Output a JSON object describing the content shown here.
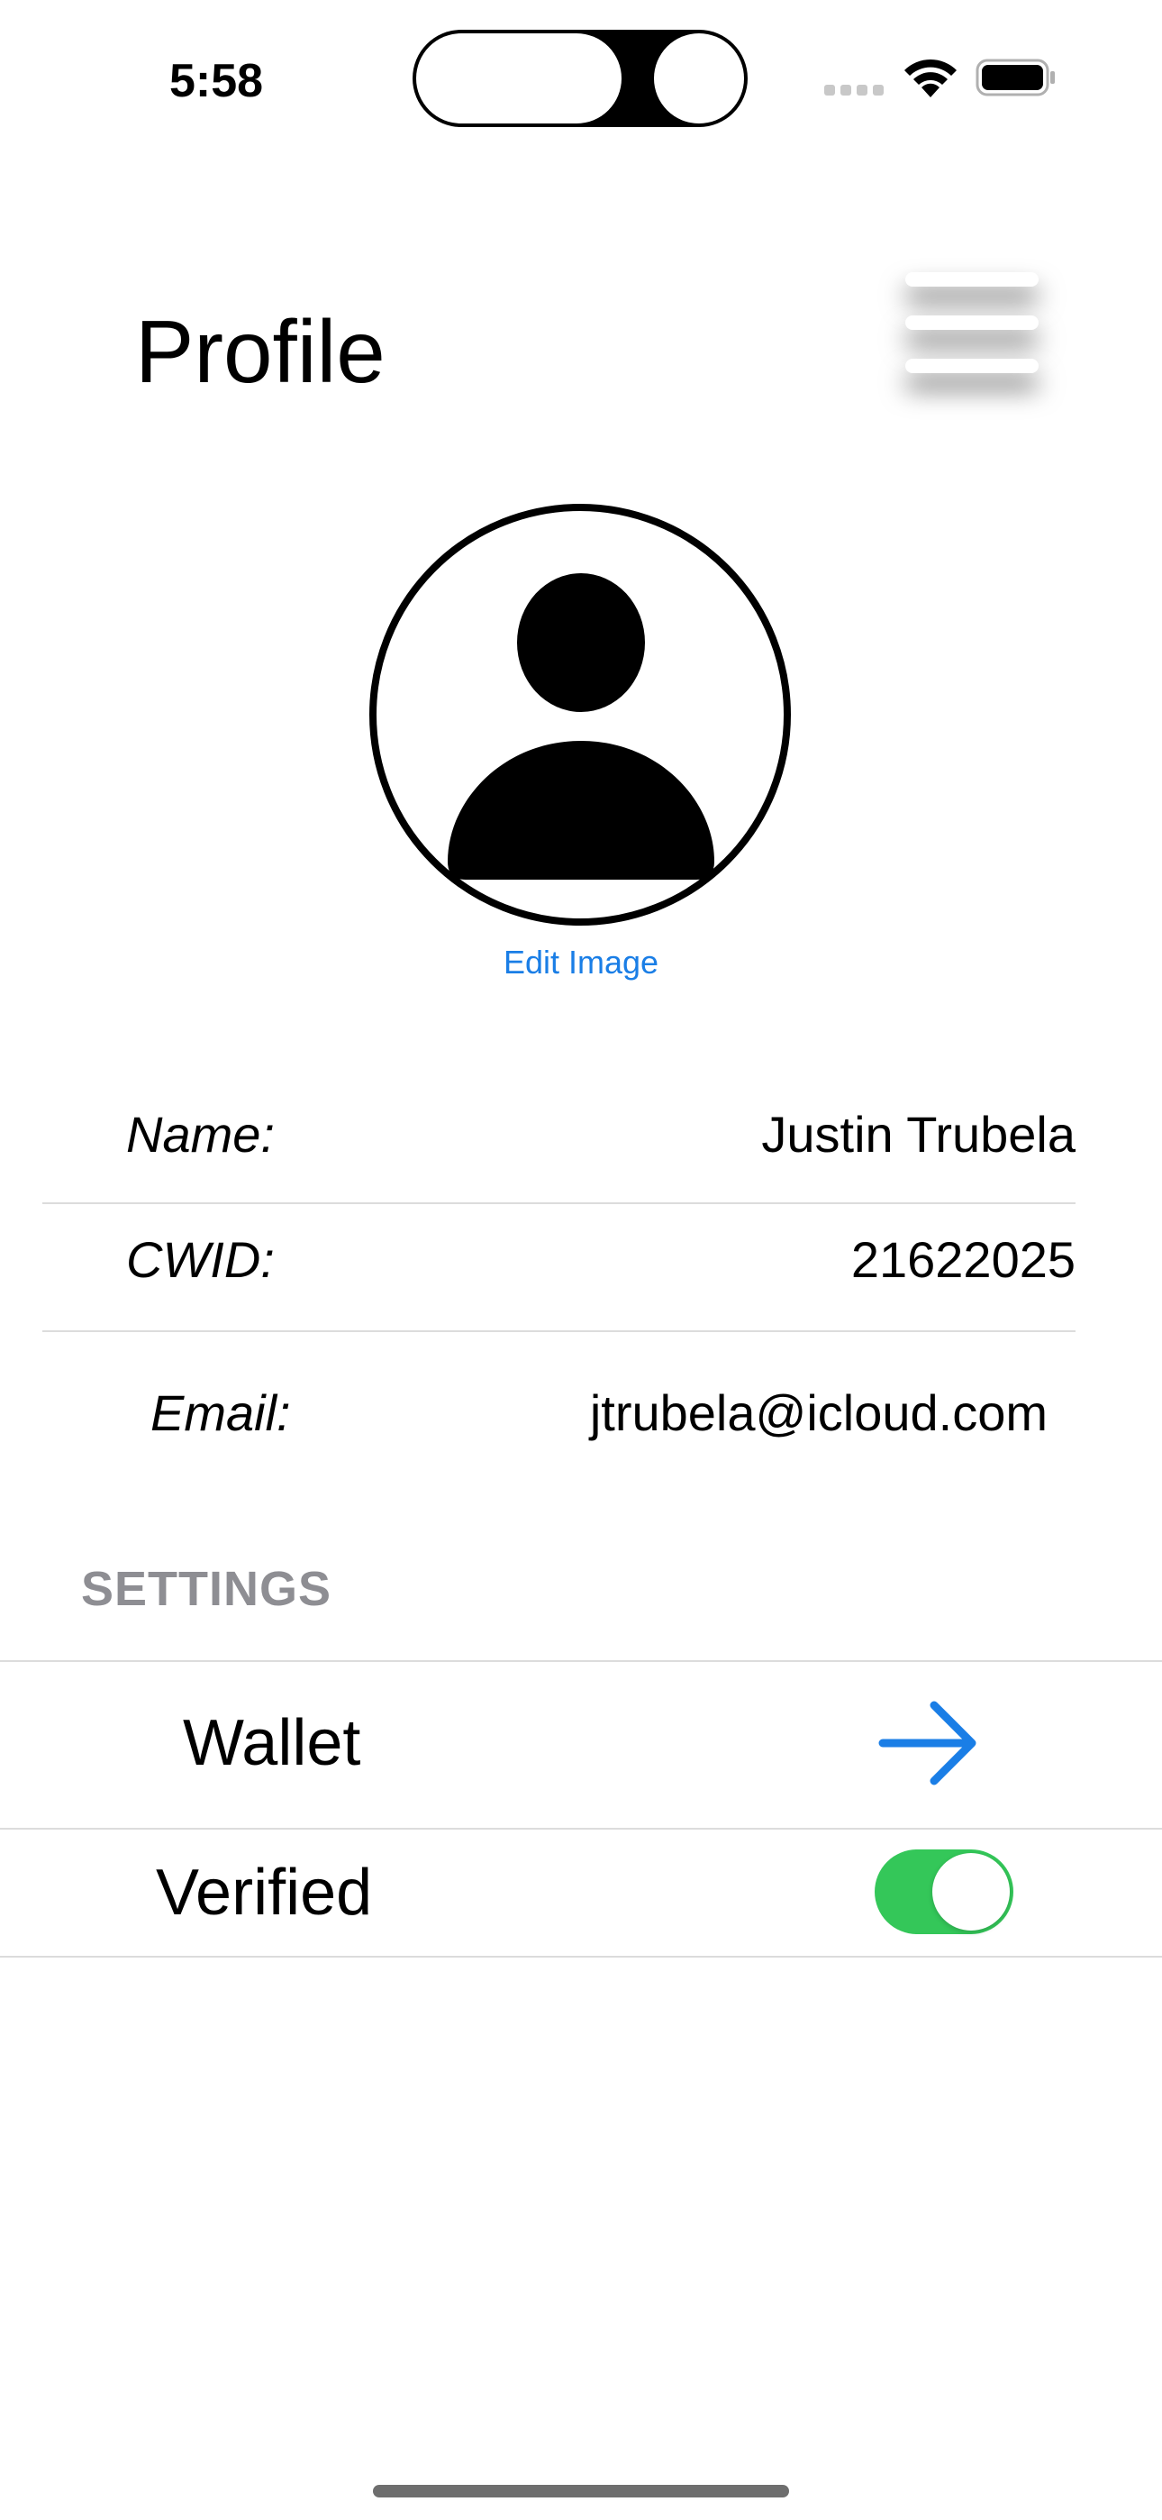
{
  "status_bar": {
    "time": "5:58",
    "wifi_icon": "wifi-icon",
    "battery_icon": "battery-icon",
    "signal_icon": "cellular-signal-icon"
  },
  "header": {
    "title": "Profile",
    "menu_icon": "hamburger-menu-icon"
  },
  "profile": {
    "avatar_icon": "person-circle-icon",
    "edit_image_label": "Edit Image"
  },
  "info": {
    "name_label": "Name:",
    "name_value": "Justin Trubela",
    "cwid_label": "CWID:",
    "cwid_value": "21622025",
    "email_label": "Email:",
    "email_value": "jtrubela@icloud.com"
  },
  "settings": {
    "header": "SETTINGS",
    "wallet_label": "Wallet",
    "wallet_icon": "arrow-right-icon",
    "verified_label": "Verified",
    "verified_on": true
  },
  "colors": {
    "accent_blue": "#1a7ee6",
    "toggle_green": "#34c759",
    "section_gray": "#8e8e93"
  }
}
